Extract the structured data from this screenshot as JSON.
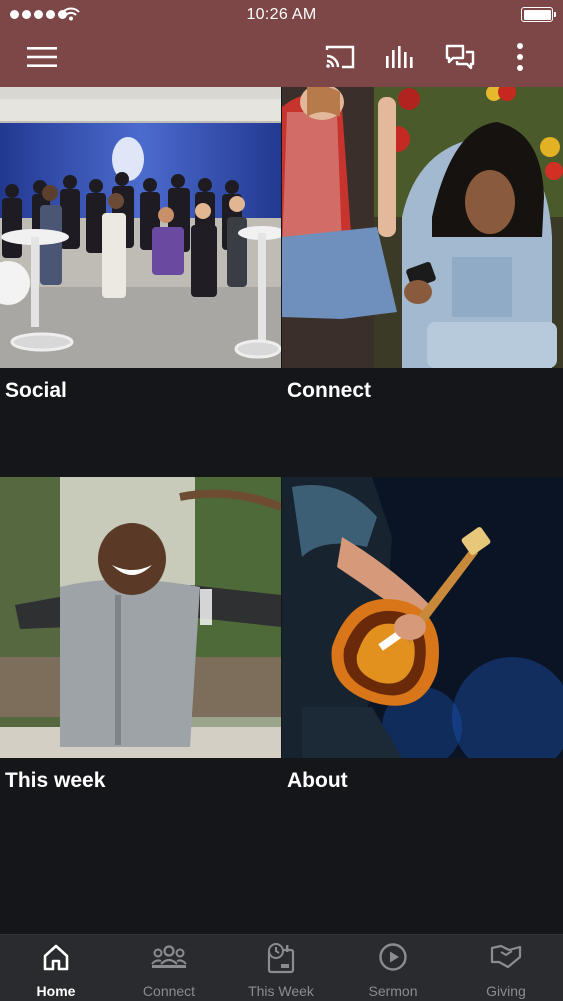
{
  "status_bar": {
    "time": "10:26 AM"
  },
  "header": {
    "icons": [
      "menu-icon",
      "cast-icon",
      "audio-bars-icon",
      "chat-icon",
      "more-vertical-icon"
    ]
  },
  "tiles": [
    {
      "title": "Social"
    },
    {
      "title": "Connect"
    },
    {
      "title": "This week"
    },
    {
      "title": "About"
    }
  ],
  "bottom_nav": {
    "items": [
      {
        "label": "Home",
        "icon": "home-icon",
        "active": true
      },
      {
        "label": "Connect",
        "icon": "group-icon",
        "active": false
      },
      {
        "label": "This Week",
        "icon": "calendar-clock-icon",
        "active": false
      },
      {
        "label": "Sermon",
        "icon": "play-circle-icon",
        "active": false
      },
      {
        "label": "Giving",
        "icon": "heart-hand-icon",
        "active": false
      }
    ]
  },
  "colors": {
    "header_bg": "#7d4747",
    "page_bg": "#15161a",
    "nav_bg": "#2a2b2f",
    "nav_inactive": "#8b8c91",
    "nav_active": "#ffffff"
  }
}
